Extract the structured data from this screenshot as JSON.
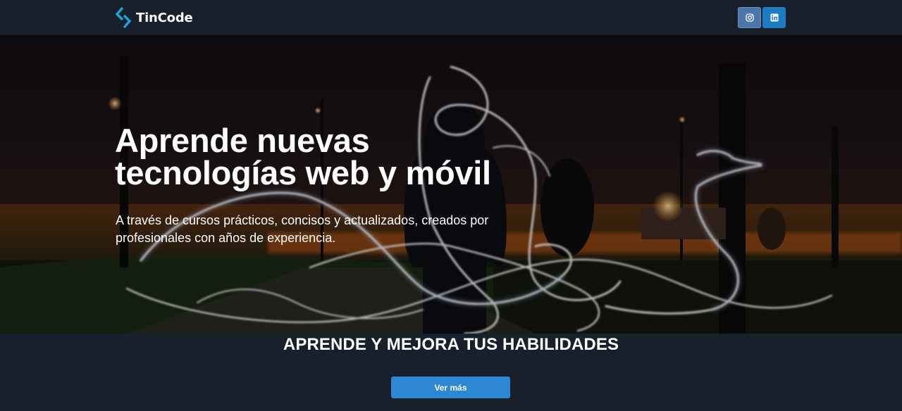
{
  "navbar": {
    "brand_name": "TinCode",
    "brand_icon": "code-bracket-logo-icon",
    "social": [
      {
        "name": "instagram",
        "icon": "instagram-icon",
        "color": "#4a76a8"
      },
      {
        "name": "linkedin",
        "icon": "linkedin-icon",
        "color": "#1d7bc2"
      }
    ]
  },
  "hero": {
    "title_line1": "Aprende nuevas",
    "title_line2": "tecnologías web y móvil",
    "subtitle_line1": "A través de cursos prácticos, concisos y actualizados, creados por",
    "subtitle_line2": "profesionales con años de experiencia."
  },
  "section": {
    "title": "APRENDE Y MEJORA TUS HABILIDADES",
    "button_label": "Ver más"
  },
  "colors": {
    "background": "#17202b",
    "accent": "#2d87d3",
    "logo": "#1ea3dc"
  }
}
